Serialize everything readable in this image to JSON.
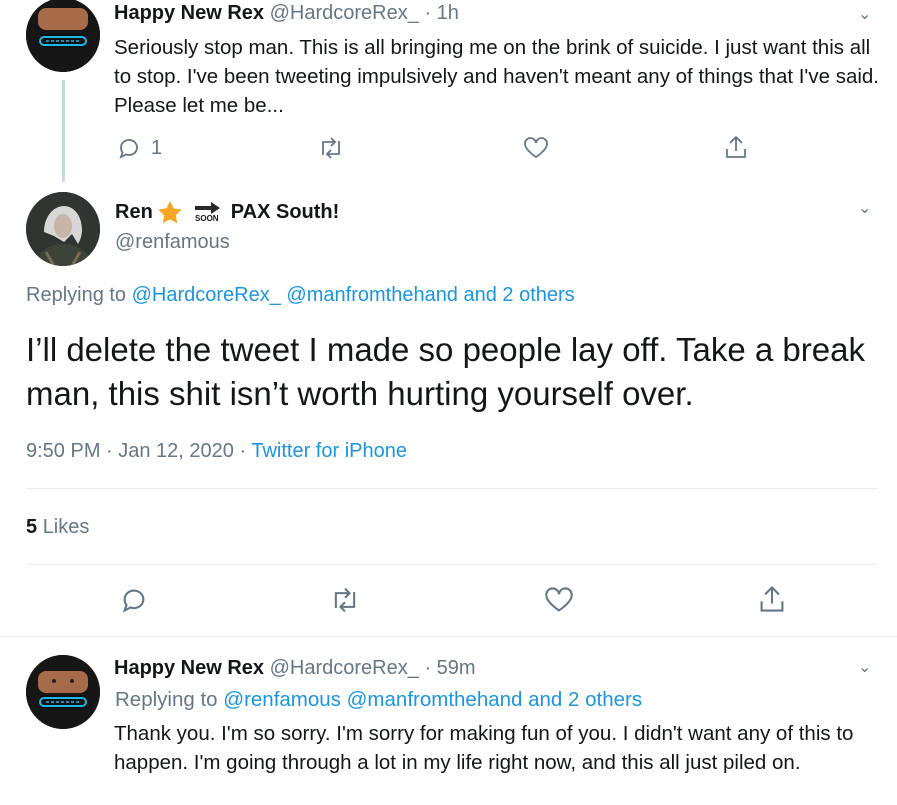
{
  "top_tweet": {
    "display_name": "Happy New Rex",
    "handle": "@HardcoreRex_",
    "time": "· 1h",
    "text": "Seriously stop man. This is all bringing me on the brink of suicide. I just want this all to stop. I've been tweeting impulsively and haven't meant any of things that I've said. Please let me be...",
    "reply_count": "1"
  },
  "main_tweet": {
    "display_name_prefix": "Ren",
    "soon_label": "SOON",
    "display_name_suffix": "PAX South!",
    "handle": "@renfamous",
    "replying_label": "Replying to",
    "replying_to": "@HardcoreRex_ @manfromthehand and 2 others",
    "text": "I’ll delete the tweet I made so people lay off. Take a break man, this shit isn’t worth hurting yourself over.",
    "timestamp": "9:50 PM · Jan 12, 2020 ·",
    "client": "Twitter for iPhone",
    "likes_count": "5",
    "likes_label": "Likes"
  },
  "reply_tweet": {
    "display_name": "Happy New Rex",
    "handle": "@HardcoreRex_",
    "time": "· 59m",
    "replying_label": "Replying to",
    "replying_to": "@renfamous @manfromthehand and 2 others",
    "text": "Thank you. I'm so sorry. I'm sorry for making fun of you. I didn't want any of this to happen. I'm going through a lot in my life right now, and this all just piled on."
  },
  "icons": [
    "reply-icon",
    "retweet-icon",
    "like-icon",
    "share-icon",
    "chevron-down-icon",
    "star-icon",
    "arrow-icon"
  ],
  "colors": {
    "accent": "#1b95e0",
    "muted": "#657786",
    "divider": "#e6ecf0",
    "star": "#f5a623"
  }
}
